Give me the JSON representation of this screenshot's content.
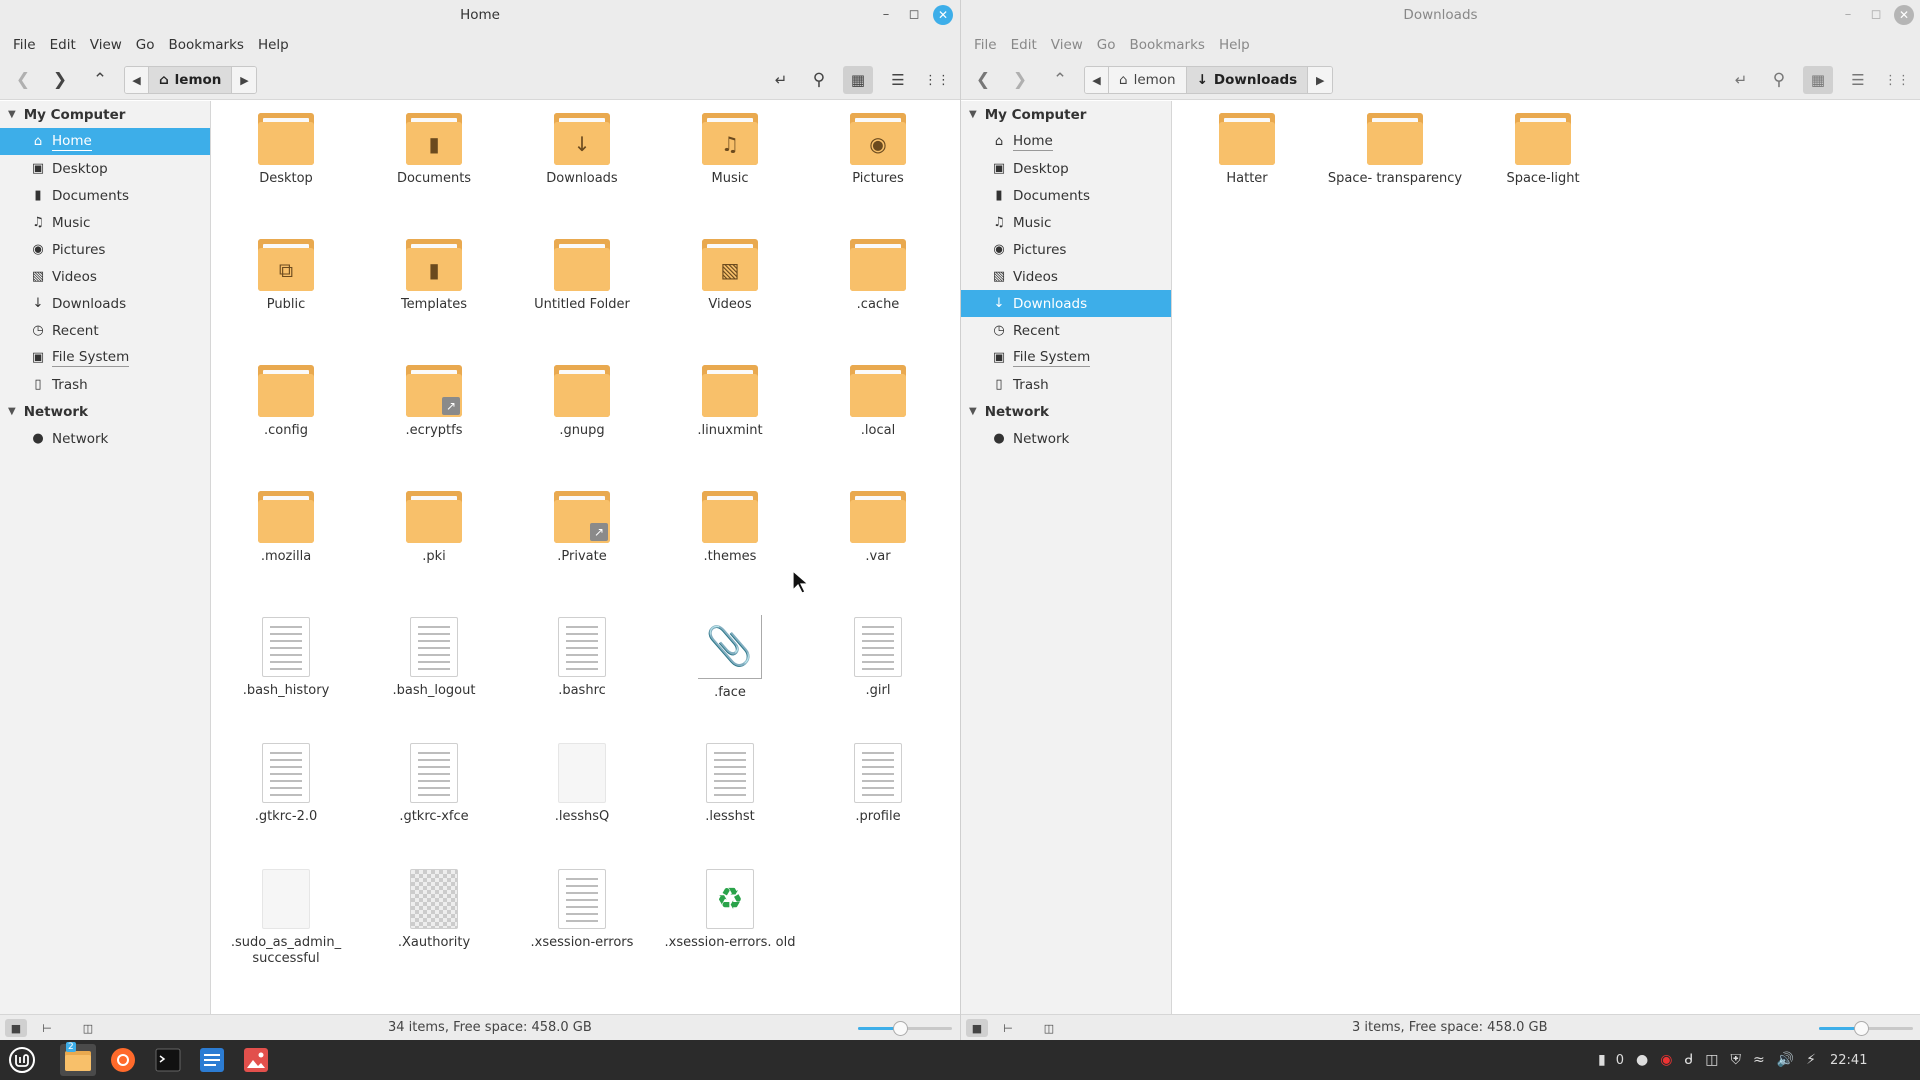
{
  "window_left": {
    "title": "Home",
    "menu": [
      "File",
      "Edit",
      "View",
      "Go",
      "Bookmarks",
      "Help"
    ],
    "breadcrumb": [
      "lemon"
    ],
    "sidebar": {
      "my_computer": "My Computer",
      "items": [
        {
          "label": "Home",
          "icon": "home-icon",
          "selected": true
        },
        {
          "label": "Desktop",
          "icon": "desktop-icon"
        },
        {
          "label": "Documents",
          "icon": "documents-icon"
        },
        {
          "label": "Music",
          "icon": "music-icon"
        },
        {
          "label": "Pictures",
          "icon": "camera-icon"
        },
        {
          "label": "Videos",
          "icon": "film-icon"
        },
        {
          "label": "Downloads",
          "icon": "download-icon"
        },
        {
          "label": "Recent",
          "icon": "clock-icon"
        },
        {
          "label": "File System",
          "icon": "drive-icon"
        },
        {
          "label": "Trash",
          "icon": "trash-icon"
        }
      ],
      "network_header": "Network",
      "network_items": [
        {
          "label": "Network",
          "icon": "globe-icon"
        }
      ]
    },
    "files": [
      {
        "name": "Desktop",
        "kind": "folder"
      },
      {
        "name": "Documents",
        "kind": "folder",
        "emblem": "doc"
      },
      {
        "name": "Downloads",
        "kind": "folder",
        "emblem": "down"
      },
      {
        "name": "Music",
        "kind": "folder",
        "emblem": "music"
      },
      {
        "name": "Pictures",
        "kind": "folder",
        "emblem": "camera"
      },
      {
        "name": "Public",
        "kind": "folder",
        "emblem": "share"
      },
      {
        "name": "Templates",
        "kind": "folder",
        "emblem": "doc"
      },
      {
        "name": "Untitled Folder",
        "kind": "folder"
      },
      {
        "name": "Videos",
        "kind": "folder",
        "emblem": "film"
      },
      {
        "name": ".cache",
        "kind": "folder"
      },
      {
        "name": ".config",
        "kind": "folder"
      },
      {
        "name": ".ecryptfs",
        "kind": "folder",
        "link": true
      },
      {
        "name": ".gnupg",
        "kind": "folder"
      },
      {
        "name": ".linuxmint",
        "kind": "folder"
      },
      {
        "name": ".local",
        "kind": "folder"
      },
      {
        "name": ".mozilla",
        "kind": "folder"
      },
      {
        "name": ".pki",
        "kind": "folder"
      },
      {
        "name": ".Private",
        "kind": "folder",
        "link": true
      },
      {
        "name": ".themes",
        "kind": "folder"
      },
      {
        "name": ".var",
        "kind": "folder"
      },
      {
        "name": ".bash_history",
        "kind": "text"
      },
      {
        "name": ".bash_logout",
        "kind": "text"
      },
      {
        "name": ".bashrc",
        "kind": "text"
      },
      {
        "name": ".face",
        "kind": "face"
      },
      {
        "name": ".girl",
        "kind": "text"
      },
      {
        "name": ".gtkrc-2.0",
        "kind": "text"
      },
      {
        "name": ".gtkrc-xfce",
        "kind": "text"
      },
      {
        "name": ".lesshsQ",
        "kind": "blank"
      },
      {
        "name": ".lesshst",
        "kind": "text"
      },
      {
        "name": ".profile",
        "kind": "text"
      },
      {
        "name": ".sudo_as_admin_ successful",
        "kind": "blank"
      },
      {
        "name": ".Xauthority",
        "kind": "checker"
      },
      {
        "name": ".xsession-errors",
        "kind": "text"
      },
      {
        "name": ".xsession-errors. old",
        "kind": "recycle"
      }
    ],
    "status": "34 items, Free space: 458.0 GB",
    "zoom_level": 0.45
  },
  "window_right": {
    "title": "Downloads",
    "menu": [
      "File",
      "Edit",
      "View",
      "Go",
      "Bookmarks",
      "Help"
    ],
    "breadcrumb": [
      "lemon",
      "Downloads"
    ],
    "sidebar": {
      "my_computer": "My Computer",
      "items": [
        {
          "label": "Home",
          "icon": "home-icon"
        },
        {
          "label": "Desktop",
          "icon": "desktop-icon"
        },
        {
          "label": "Documents",
          "icon": "documents-icon"
        },
        {
          "label": "Music",
          "icon": "music-icon"
        },
        {
          "label": "Pictures",
          "icon": "camera-icon"
        },
        {
          "label": "Videos",
          "icon": "film-icon"
        },
        {
          "label": "Downloads",
          "icon": "download-icon",
          "selected": true
        },
        {
          "label": "Recent",
          "icon": "clock-icon"
        },
        {
          "label": "File System",
          "icon": "drive-icon"
        },
        {
          "label": "Trash",
          "icon": "trash-icon"
        }
      ],
      "network_header": "Network",
      "network_items": [
        {
          "label": "Network",
          "icon": "globe-icon"
        }
      ]
    },
    "files": [
      {
        "name": "Hatter",
        "kind": "folder"
      },
      {
        "name": "Space- transparency",
        "kind": "folder"
      },
      {
        "name": "Space-light",
        "kind": "folder"
      }
    ],
    "status": "3 items, Free space: 458.0 GB",
    "zoom_level": 0.45
  },
  "taskbar": {
    "workspace_badge": "2",
    "tray": {
      "notification_count": "0",
      "clock": "22:41"
    }
  },
  "colors": {
    "accent": "#3daee9",
    "folder": "#f8c06a",
    "folder_back": "#e9a94f",
    "taskbar": "#2b2b2b"
  }
}
